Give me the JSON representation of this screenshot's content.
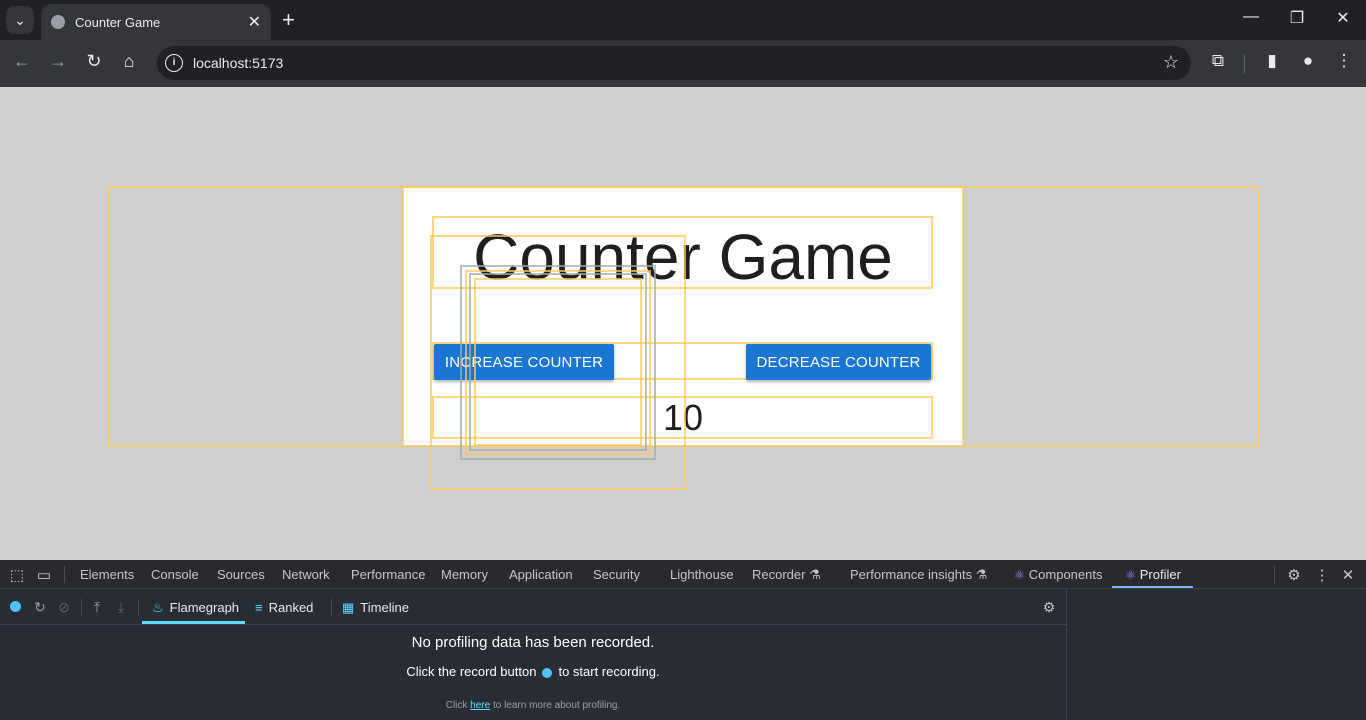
{
  "browser": {
    "tab_title": "Counter Game",
    "url": "localhost:5173",
    "icons": {
      "tab_menu": "chevron-down-icon",
      "close_tab": "close-icon",
      "new_tab": "plus-icon",
      "back": "arrow-left-icon",
      "forward": "arrow-right-icon",
      "reload": "reload-icon",
      "home": "home-icon",
      "site_info": "info-icon",
      "bookmark": "star-icon",
      "extensions": "puzzle-icon",
      "sidepanel": "side-panel-icon",
      "profile": "profile-icon",
      "menu": "kebab-menu-icon"
    }
  },
  "page": {
    "title": "Counter Game",
    "increase_label": "INCREASE COUNTER",
    "decrease_label": "DECREASE COUNTER",
    "counter_value": "10",
    "button_color": "#1976d2",
    "highlight_color": "#ffc85a"
  },
  "devtools": {
    "tabs": [
      "Elements",
      "Console",
      "Sources",
      "Network",
      "Performance",
      "Memory",
      "Application",
      "Security",
      "Lighthouse",
      "Recorder",
      "Performance insights",
      "Components",
      "Profiler"
    ],
    "active_tab": "Profiler",
    "profiler": {
      "tabs": [
        "Flamegraph",
        "Ranked",
        "Timeline"
      ],
      "active_tab": "Flamegraph",
      "empty_title": "No profiling data has been recorded.",
      "hint_before": "Click the record button",
      "hint_after": "to start recording.",
      "learn_before": "Click",
      "learn_link": "here",
      "learn_after": "to learn more about profiling."
    }
  }
}
